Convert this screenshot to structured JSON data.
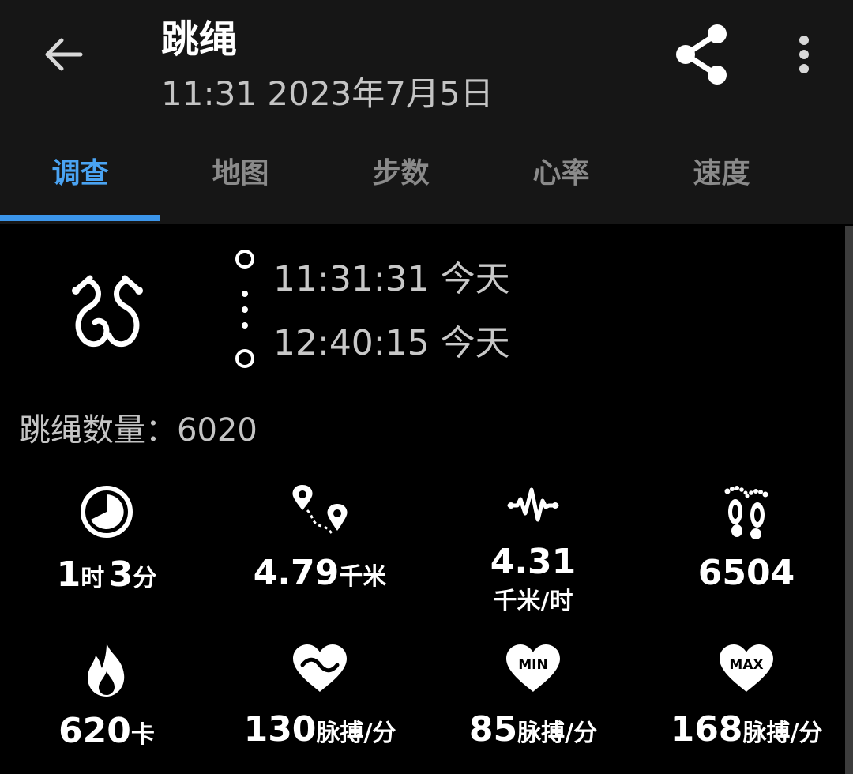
{
  "header": {
    "title": "跳绳",
    "datetime": "11:31 2023年7月5日"
  },
  "tabs": [
    {
      "label": "调查",
      "active": true
    },
    {
      "label": "地图",
      "active": false
    },
    {
      "label": "步数",
      "active": false
    },
    {
      "label": "心率",
      "active": false
    },
    {
      "label": "速度",
      "active": false
    }
  ],
  "activity": {
    "icon": "jump-rope-icon",
    "start_time": "11:31:31 今天",
    "end_time": "12:40:15 今天",
    "jump_count_label": "跳绳数量：",
    "jump_count_value": "6020"
  },
  "stats": {
    "duration": {
      "icon": "clock-icon",
      "hours": "1",
      "hours_unit": "时",
      "minutes": "3",
      "minutes_unit": "分"
    },
    "distance": {
      "icon": "route-icon",
      "value": "4.79",
      "unit": "千米"
    },
    "speed": {
      "icon": "pulse-wave-icon",
      "value": "4.31",
      "unit": "千米/时"
    },
    "steps": {
      "icon": "footprints-icon",
      "value": "6504"
    },
    "calories": {
      "icon": "flame-icon",
      "value": "620",
      "unit": "卡"
    },
    "avg_heart_rate": {
      "icon": "heart-wave-icon",
      "value": "130",
      "unit": "脉搏/分"
    },
    "min_heart_rate": {
      "icon": "heart-min-icon",
      "badge": "MIN",
      "value": "85",
      "unit": "脉搏/分"
    },
    "max_heart_rate": {
      "icon": "heart-max-icon",
      "badge": "MAX",
      "value": "168",
      "unit": "脉搏/分"
    }
  },
  "colors": {
    "accent": "#3b95ea",
    "header_bg": "#161616",
    "background": "#000000"
  }
}
